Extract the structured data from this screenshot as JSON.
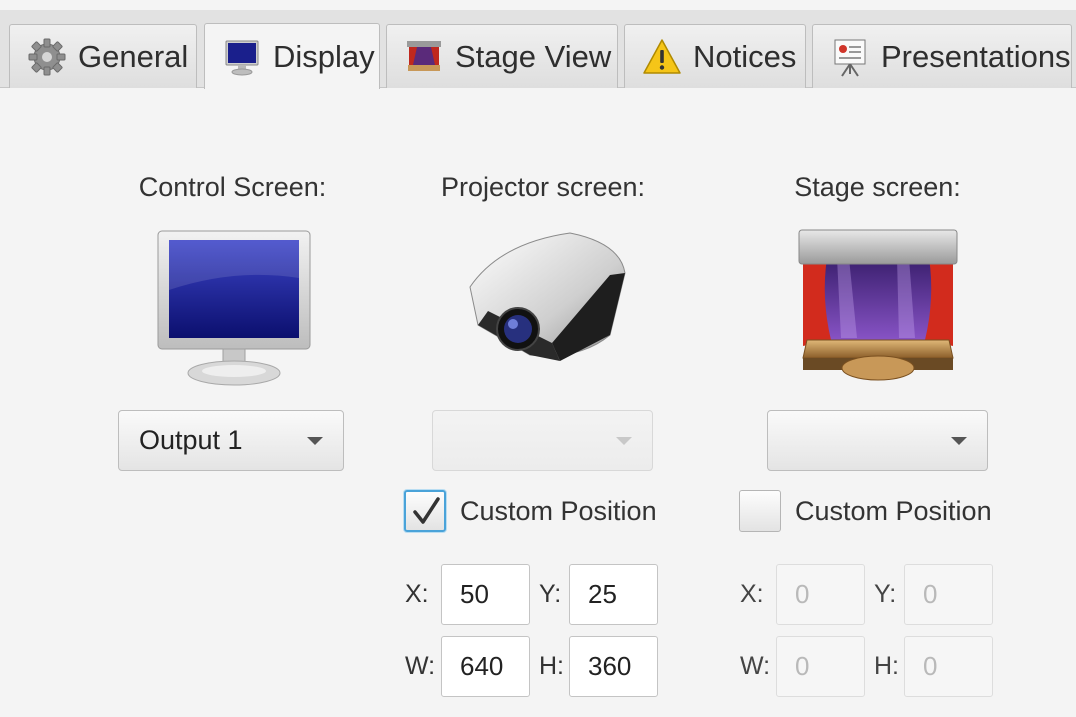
{
  "tabs": [
    {
      "label": "General",
      "icon": "gear-icon",
      "active": false
    },
    {
      "label": "Display",
      "icon": "monitor-icon",
      "active": true
    },
    {
      "label": "Stage View",
      "icon": "stage-icon",
      "active": false
    },
    {
      "label": "Notices",
      "icon": "warning-icon",
      "active": false
    },
    {
      "label": "Presentations",
      "icon": "presentation-board-icon",
      "active": false
    }
  ],
  "control": {
    "label": "Control Screen:",
    "image": "monitor-image",
    "selected": "Output 1"
  },
  "projector": {
    "label": "Projector screen:",
    "image": "projector-image",
    "selected": "",
    "custom_position": {
      "label": "Custom Position",
      "checked": true
    },
    "x_label": "X:",
    "x": "50",
    "y_label": "Y:",
    "y": "25",
    "w_label": "W:",
    "w": "640",
    "h_label": "H:",
    "h": "360"
  },
  "stage": {
    "label": "Stage screen:",
    "image": "stage-image",
    "selected": "",
    "custom_position": {
      "label": "Custom Position",
      "checked": false
    },
    "x_label": "X:",
    "x": "0",
    "y_label": "Y:",
    "y": "0",
    "w_label": "W:",
    "w": "0",
    "h_label": "H:",
    "h": "0"
  },
  "colors": {
    "accent": "#4aa3d9",
    "tab_bg": "#e2e2e2",
    "panel_bg": "#f4f4f4"
  }
}
